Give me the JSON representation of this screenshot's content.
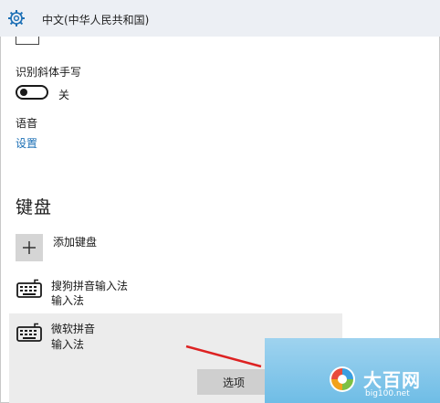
{
  "window": {
    "title": "中文(中华人民共和国)"
  },
  "handwriting": {
    "label": "识别斜体手写",
    "toggle_state": "关"
  },
  "speech": {
    "label": "语音",
    "settings_link": "设置"
  },
  "keyboard": {
    "section_title": "键盘",
    "add_label": "添加键盘",
    "items": [
      {
        "name": "搜狗拼音输入法",
        "subtitle": "输入法"
      },
      {
        "name": "微软拼音",
        "subtitle": "输入法"
      }
    ],
    "options_button": "选项"
  },
  "watermark": {
    "brand": "大百网",
    "url": "big100.net"
  },
  "colors": {
    "accent_link": "#1b6fb5",
    "titlebar": "#eceff4",
    "highlight_row": "#ececec"
  }
}
